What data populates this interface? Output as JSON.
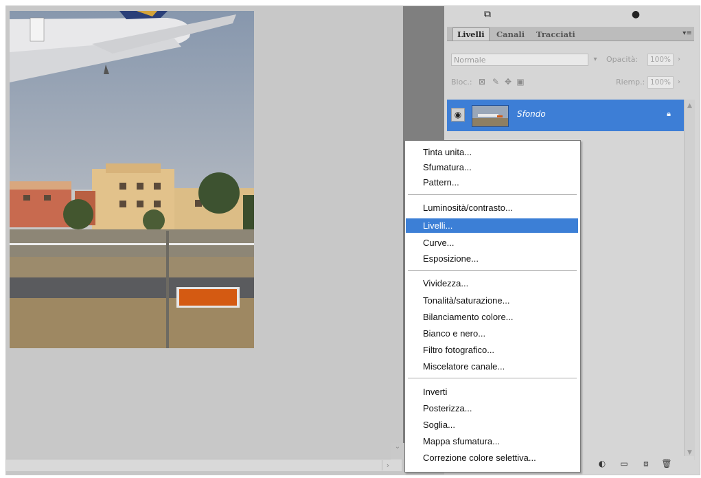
{
  "panel": {
    "tabs": [
      "Livelli",
      "Canali",
      "Tracciati"
    ],
    "blend_mode": "Normale",
    "opacity_label": "Opacità:",
    "opacity_value": "100%",
    "lock_label": "Bloc.:",
    "fill_label": "Riemp.:",
    "fill_value": "100%"
  },
  "layers": [
    {
      "name": "Sfondo",
      "visible": true,
      "locked": true
    }
  ],
  "menu": {
    "selected": "Livelli...",
    "groups": [
      [
        "Tinta unita...",
        "Sfumatura...",
        "Pattern..."
      ],
      [
        "Luminosità/contrasto...",
        "Livelli...",
        "Curve...",
        "Esposizione..."
      ],
      [
        "Vividezza...",
        "Tonalità/saturazione...",
        "Bilanciamento colore...",
        "Bianco e nero...",
        "Filtro fotografico...",
        "Miscelatore canale..."
      ],
      [
        "Inverti",
        "Posterizza...",
        "Soglia...",
        "Mappa sfumatura...",
        "Correzione colore selettiva..."
      ]
    ]
  },
  "colors": {
    "selection": "#3c7fd6",
    "panel_bg": "#d6d6d6",
    "canvas_bg": "#c8c8c8"
  }
}
